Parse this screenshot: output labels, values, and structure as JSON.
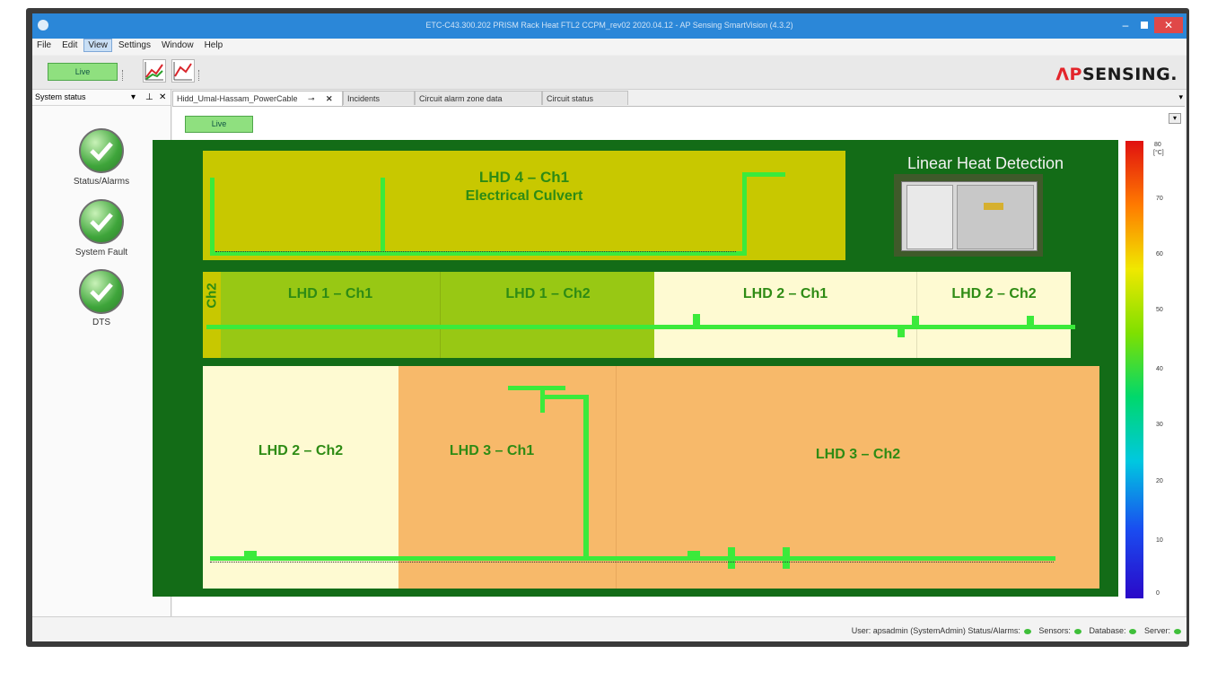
{
  "window": {
    "title": "ETC-C43.300.202 PRISM Rack Heat FTL2 CCPM_rev02 2020.04.12 - AP Sensing SmartVision (4.3.2)"
  },
  "menu": [
    "File",
    "Edit",
    "View",
    "Settings",
    "Window",
    "Help"
  ],
  "toolbar": {
    "live_label": "Live",
    "logo_prefix": "ΛP",
    "logo_suffix": "SENSING."
  },
  "sidebar": {
    "title": "System status",
    "items": [
      {
        "label": "Status/Alarms"
      },
      {
        "label": "System Fault"
      },
      {
        "label": "DTS"
      }
    ]
  },
  "tabs": [
    {
      "label": "Hidd_Umal-Hassam_PowerCable"
    },
    {
      "label": "Incidents"
    },
    {
      "label": "Circuit alarm zone data"
    },
    {
      "label": "Circuit status"
    }
  ],
  "content": {
    "live_label": "Live"
  },
  "diagram": {
    "title": "Linear Heat Detection",
    "zones": [
      {
        "line1": "LHD 4 – Ch1",
        "line2": "Electrical Culvert"
      },
      {
        "label": "Ch2"
      },
      {
        "label": "LHD 1 – Ch1"
      },
      {
        "label": "LHD 1 – Ch2"
      },
      {
        "label": "LHD 2 – Ch1"
      },
      {
        "label": "LHD 2 – Ch2"
      },
      {
        "label": "LHD 2 – Ch2"
      },
      {
        "label": "LHD 3 – Ch1"
      },
      {
        "label": "LHD 3 – Ch2"
      }
    ]
  },
  "color_scale": {
    "unit": "[°C]",
    "ticks": [
      "80",
      "70",
      "60",
      "50",
      "40",
      "30",
      "20",
      "10",
      "0"
    ]
  },
  "statusbar": {
    "user": "User: apsadmin (SystemAdmin)",
    "status_alarms": "Status/Alarms:",
    "sensors": "Sensors:",
    "database": "Database:",
    "server": "Server:"
  },
  "colors": {
    "titlebar": "#2b87d8",
    "map_bg": "#136c17",
    "cable": "#3bea3b",
    "zone_olive": "#c8c800",
    "zone_pale": "#fefad2",
    "zone_orange": "#f7b96a",
    "zone_green": "#98c814"
  }
}
